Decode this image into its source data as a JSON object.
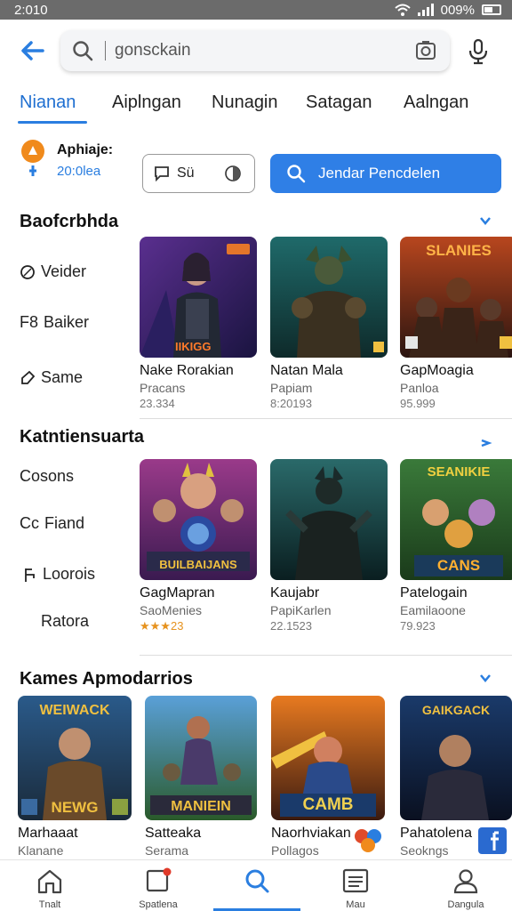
{
  "status": {
    "time": "2:010",
    "battery": "009%"
  },
  "search": {
    "value": "gonsckain"
  },
  "tabs": [
    {
      "label": "Nianan",
      "active": true
    },
    {
      "label": "Aiplngan",
      "active": false
    },
    {
      "label": "Nunagin",
      "active": false
    },
    {
      "label": "Satagan",
      "active": false
    },
    {
      "label": "Aalngan",
      "active": false
    }
  ],
  "filter": {
    "pin_title": "Aphiaje:",
    "pin_sub": "20:0lea",
    "chip_label": "Sü",
    "primary_label": "Jendar Pencdelen"
  },
  "sections": [
    {
      "title": "Baofcrbhda",
      "side": [
        "Veider",
        "Baiker",
        "Same"
      ],
      "side_prefix": [
        "",
        "F8",
        ""
      ],
      "cards": [
        {
          "title": "Nake Rorakian",
          "sub": "Pracans",
          "meta": "23.334",
          "badge": ""
        },
        {
          "title": "Natan Mala",
          "sub": "Papiam",
          "meta": "8:20193",
          "badge": ""
        },
        {
          "title": "GapMoagia",
          "sub": "Panloa",
          "meta": "95.999",
          "badge": "SLANIES"
        }
      ]
    },
    {
      "title": "Katntiensuarta",
      "side": [
        "Cosons",
        "Fiand",
        "Loorois",
        "Ratora"
      ],
      "side_prefix": [
        "",
        "Cc",
        "",
        ""
      ],
      "cards": [
        {
          "title": "GagMapran",
          "sub": "SaoMenies",
          "meta": "★★★23",
          "badge": "BUILBAIJANS"
        },
        {
          "title": "Kaujabr",
          "sub": "PapiKarlen",
          "meta": "22.1523",
          "badge": ""
        },
        {
          "title": "Patelogain",
          "sub": "Eamilaoone",
          "meta": "79.923",
          "badge": "CANS"
        }
      ]
    },
    {
      "title": "Kames Apmodarrios",
      "cards": [
        {
          "title": "Marhaaat",
          "sub": "Klanane",
          "badge": "NEWG",
          "topbadge": "WEIWACK"
        },
        {
          "title": "Satteaka",
          "sub": "Serama",
          "badge": "MANIEIN",
          "topbadge": ""
        },
        {
          "title": "Naorhviakan",
          "sub": "Pollagos",
          "badge": "CAMB",
          "topbadge": ""
        },
        {
          "title": "Pahatolena",
          "sub": "Seokngs",
          "badge": "",
          "topbadge": "GAIKGACK"
        }
      ]
    }
  ],
  "nav": [
    {
      "label": "Tnalt"
    },
    {
      "label": "Spatlena"
    },
    {
      "label": ""
    },
    {
      "label": "Mau"
    },
    {
      "label": "Dangula"
    }
  ],
  "colors": {
    "accent": "#2f7fe6",
    "star": "#e6921e"
  }
}
